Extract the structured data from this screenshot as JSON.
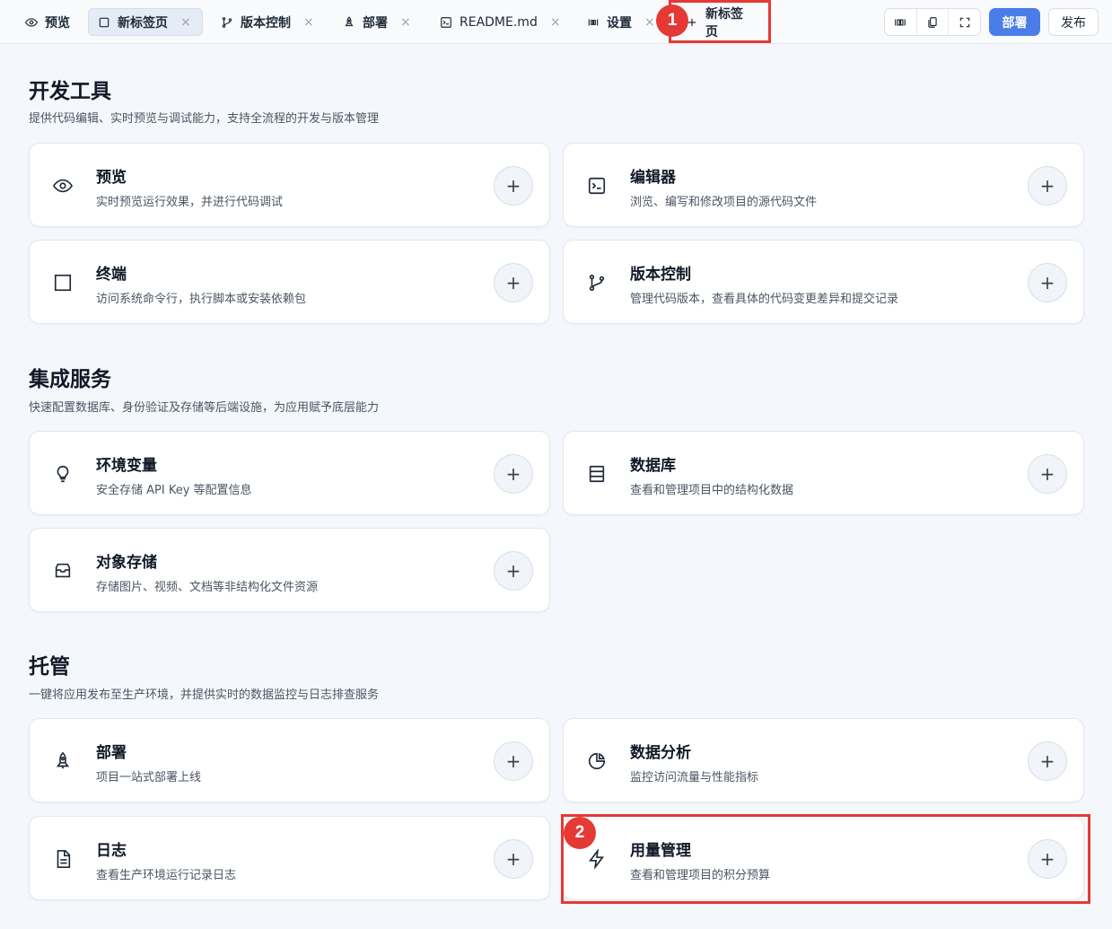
{
  "tabs": [
    {
      "label": "预览",
      "icon": "eye-icon"
    },
    {
      "label": "新标签页",
      "icon": "square-icon"
    },
    {
      "label": "版本控制",
      "icon": "git-branch-icon"
    },
    {
      "label": "部署",
      "icon": "rocket-icon"
    },
    {
      "label": "README.md",
      "icon": "terminal-file-icon"
    },
    {
      "label": "设置",
      "icon": "settings-sliders-icon"
    },
    {
      "label": "新标签页",
      "icon": "plus-icon"
    }
  ],
  "toolbar": {
    "deploy_label": "部署",
    "publish_label": "发布"
  },
  "sections": [
    {
      "title": "开发工具",
      "desc": "提供代码编辑、实时预览与调试能力，支持全流程的开发与版本管理",
      "cards": [
        {
          "title": "预览",
          "desc": "实时预览运行效果，并进行代码调试",
          "icon": "eye-icon"
        },
        {
          "title": "编辑器",
          "desc": "浏览、编写和修改项目的源代码文件",
          "icon": "terminal-icon"
        },
        {
          "title": "终端",
          "desc": "访问系统命令行，执行脚本或安装依赖包",
          "icon": "square-icon"
        },
        {
          "title": "版本控制",
          "desc": "管理代码版本，查看具体的代码变更差异和提交记录",
          "icon": "git-branch-icon"
        }
      ]
    },
    {
      "title": "集成服务",
      "desc": "快速配置数据库、身份验证及存储等后端设施，为应用赋予底层能力",
      "cards": [
        {
          "title": "环境变量",
          "desc": "安全存储 API Key 等配置信息",
          "icon": "lightbulb-icon"
        },
        {
          "title": "数据库",
          "desc": "查看和管理项目中的结构化数据",
          "icon": "database-icon"
        },
        {
          "title": "对象存储",
          "desc": "存储图片、视频、文档等非结构化文件资源",
          "icon": "archive-icon"
        }
      ]
    },
    {
      "title": "托管",
      "desc": "一键将应用发布至生产环境，并提供实时的数据监控与日志排查服务",
      "cards": [
        {
          "title": "部署",
          "desc": "项目一站式部署上线",
          "icon": "rocket-icon"
        },
        {
          "title": "数据分析",
          "desc": "监控访问流量与性能指标",
          "icon": "pie-chart-icon"
        },
        {
          "title": "日志",
          "desc": "查看生产环境运行记录日志",
          "icon": "file-text-icon"
        },
        {
          "title": "用量管理",
          "desc": "查看和管理项目的积分预算",
          "icon": "zap-icon"
        }
      ]
    }
  ],
  "plus_glyph": "+",
  "close_glyph": "×",
  "markers": [
    "1",
    "2"
  ],
  "colors": {
    "accent": "#4a7de8",
    "highlight": "#e53935"
  }
}
